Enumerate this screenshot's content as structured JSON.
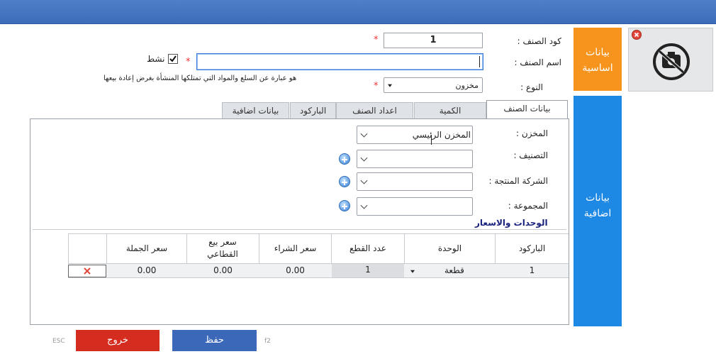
{
  "colors": {
    "topbar": "#3f6fbd",
    "orange_tab": "#f7941e",
    "blue_tab": "#1e88e5",
    "save": "#3b68b8",
    "exit": "#d42c1f"
  },
  "sidebar": {
    "basic_label": "بيانات اساسية",
    "extra_label": "بيانات اضافية"
  },
  "form": {
    "code_label": "كود الصنف :",
    "code_value": "1",
    "name_label": "اسم الصنف :",
    "name_value": "",
    "active_label": "نشط",
    "type_label": "النوع :",
    "type_value": "مخزون",
    "type_note": "هو عبارة عن السلع والمواد التي تمتلكها المنشأة بغرض إعادة بيعها",
    "required_mark": "*"
  },
  "tabs": [
    "بيانات الصنف",
    "الكمية",
    "اعداد الصنف",
    "الباركود",
    "بيانات اضافية"
  ],
  "details": {
    "store_label": "المخزن :",
    "store_value": "المخزن الرئيسي",
    "class_label": "التصنيف :",
    "company_label": "الشركة المنتجة :",
    "group_label": "المجموعة :",
    "section_title": "الوحدات والاسعار"
  },
  "table": {
    "headers": [
      "الباركود",
      "الوحدة",
      "عدد القطع",
      "سعر الشراء",
      "سعر بيع القطاعي",
      "سعر الجملة"
    ],
    "row": {
      "barcode": "1",
      "unit": "قطعة",
      "pieces": "1",
      "purchase": "0.00",
      "retail": "0.00",
      "wholesale": "0.00"
    }
  },
  "buttons": {
    "save": "حفظ",
    "save_key": "f2",
    "exit": "خروج",
    "exit_key": "ESC"
  },
  "icons": {
    "remove_image": "close-circle-icon",
    "no_camera": "no-camera-icon",
    "add": "plus-circle-icon",
    "delete_row": "delete-x-icon"
  }
}
